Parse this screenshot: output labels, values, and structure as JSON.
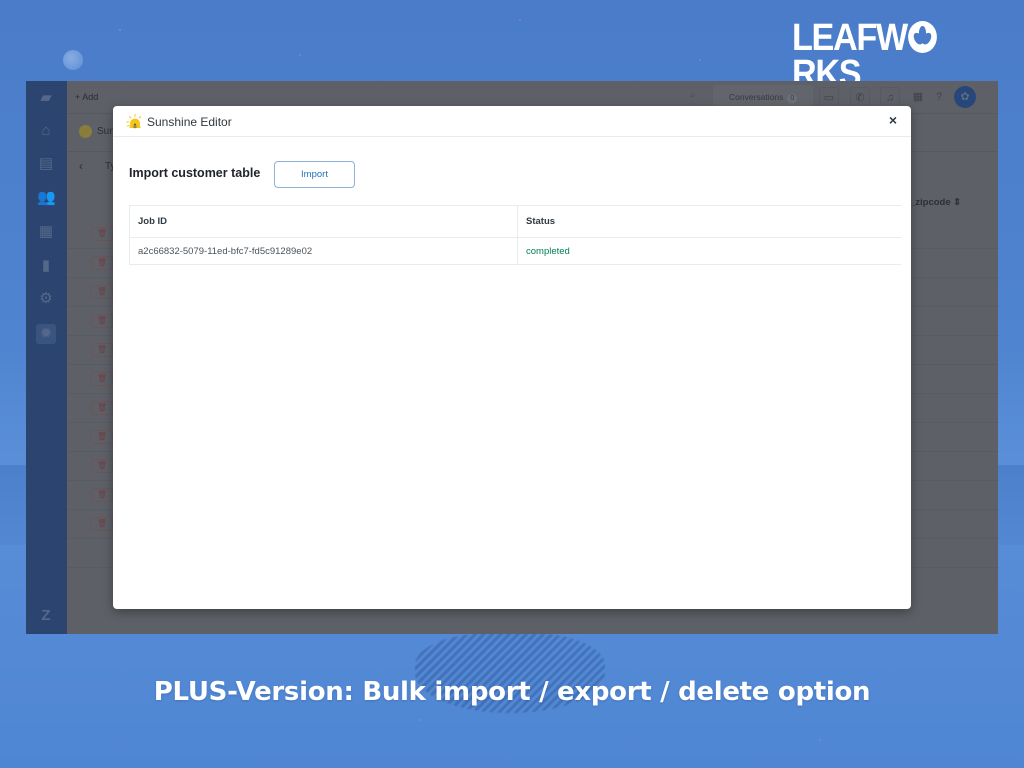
{
  "brand": {
    "logo_text_left": "LEAFW",
    "logo_text_right": "RKS",
    "logo_icon": "leaf-icon"
  },
  "caption": "PLUS-Version: Bulk import / export / delete option",
  "app": {
    "topbar": {
      "add_label": "+ Add",
      "search_icon": "search-icon",
      "conversations_label": "Conversations",
      "conversations_count": "0",
      "icons": [
        "chat-icon",
        "phone-icon",
        "bell-icon",
        "apps-grid-icon",
        "help-icon",
        "avatar"
      ]
    },
    "sidebar": {
      "icons": [
        "zendesk-logo-icon",
        "home-icon",
        "inbox-icon",
        "users-icon",
        "organizations-icon",
        "reporting-icon",
        "settings-icon",
        "sunshine-app-icon",
        "zendesk-z-icon"
      ],
      "active": "sunshine-app-icon"
    },
    "sub_header": {
      "app_name_partial": "Sun",
      "back_icon": "chevron-left-icon",
      "type_label_partial": "Ty"
    },
    "background_table": {
      "visible_column_header": "er_zipcode ⇕",
      "row_count": 11,
      "row_action_icon": "trash-icon"
    }
  },
  "modal": {
    "title": "Sunshine Editor",
    "logo_icon": "sunshine-logo-icon",
    "close_label": "×",
    "section_title": "Import customer table",
    "import_button": "Import",
    "table": {
      "headers": [
        "Job ID",
        "Status"
      ],
      "rows": [
        {
          "job_id": "a2c66832-5079-11ed-bfc7-fd5c91289e02",
          "status": "completed"
        }
      ]
    }
  },
  "colors": {
    "status_completed": "#038153",
    "import_button_text": "#1f73b7",
    "background_blue": "#4a7cc9"
  }
}
